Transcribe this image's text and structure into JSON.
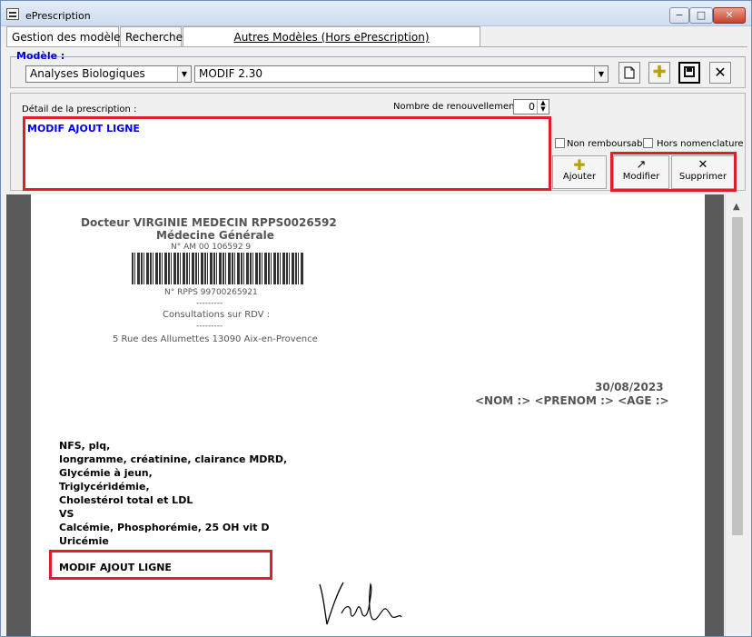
{
  "window": {
    "title": "ePrescription",
    "controls": {
      "minimize": "−",
      "maximize": "□",
      "close": "✕"
    }
  },
  "tabs": [
    "Gestion des modèles",
    "Recherche",
    "Autres Modèles (Hors ePrescription)"
  ],
  "model_group": {
    "label": "Modèle :",
    "type_select": "Analyses Biologiques",
    "model_select": "MODIF 2.30",
    "toolbar_icons": [
      "new-document-icon",
      "add-icon",
      "save-icon",
      "delete-icon"
    ]
  },
  "detail": {
    "label": "Détail de la prescription :",
    "renewal_label": "Nombre de renouvellement :",
    "renewal_value": "0",
    "text": "MODIF AJOUT LIGNE",
    "checkbox_non_remb": "Non remboursable",
    "checkbox_hors_nom": "Hors nomenclature",
    "buttons": {
      "add": "Ajouter",
      "modify": "Modifier",
      "delete": "Supprimer"
    }
  },
  "preview": {
    "doctor": "Docteur VIRGINIE MEDECIN RPPS0026592",
    "specialty": "Médecine Générale",
    "am_number": "N° AM 00 106592 9",
    "rpps": "N° RPPS 99700265921",
    "separator": "---------",
    "consultations": "Consultations sur RDV :",
    "address": "5 Rue des Allumettes 13090 Aix-en-Provence",
    "date": "30/08/2023",
    "patient_placeholder": "<NOM :> <PRENOM :> <AGE :>",
    "lines": [
      "NFS, plq,",
      "Iongramme, créatinine, clairance MDRD,",
      "Glycémie à jeun,",
      "Triglycéridémie,",
      "Cholestérol total et LDL",
      "VS",
      "Calcémie, Phosphorémie, 25 OH vit D",
      "Uricémie"
    ],
    "new_line": "MODIF AJOUT LIGNE"
  },
  "colors": {
    "highlight": "#e21d2b",
    "detail_text": "#0000ee",
    "group_label": "#0000cc"
  }
}
